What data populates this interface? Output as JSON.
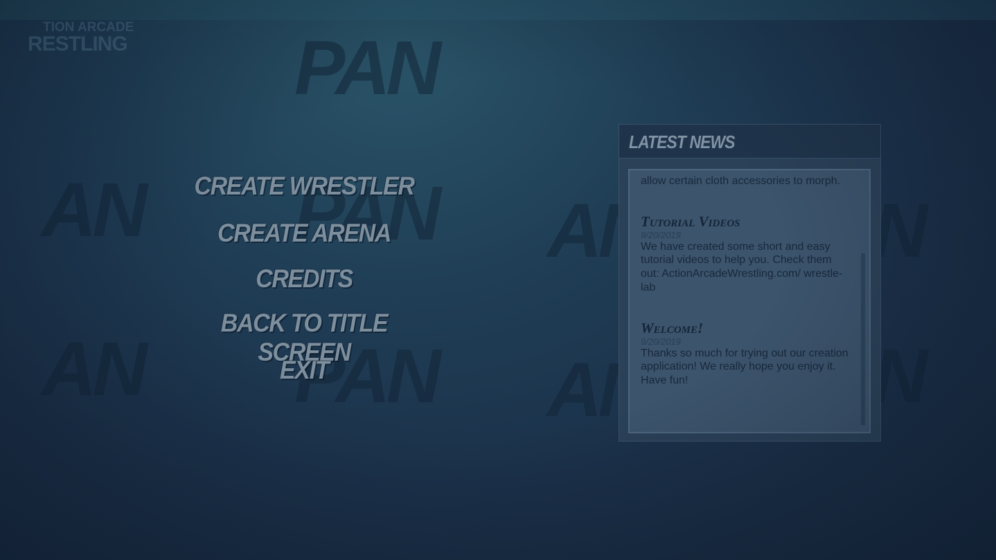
{
  "logo": {
    "line1": "TION ARCADE",
    "line2": "RESTLING"
  },
  "menu": {
    "items": [
      {
        "label": "Create Wrestler"
      },
      {
        "label": "Create Arena"
      },
      {
        "label": "Credits"
      },
      {
        "label": "Back to Title Screen"
      },
      {
        "label": "Exit"
      }
    ]
  },
  "news": {
    "title": "Latest News",
    "partial_text": "allow certain cloth accessories to morph.",
    "entries": [
      {
        "title": "Tutorial Videos",
        "date": "9/20/2019",
        "body": "We have created some short and easy tutorial videos to help you. Check them out: ActionArcadeWrestling.com/ wrestle-lab"
      },
      {
        "title": "Welcome!",
        "date": "9/20/2019",
        "body": "Thanks so much for trying out our creation application! We really hope you enjoy it. Have fun!"
      }
    ]
  },
  "colors": {
    "background": "#1f3d55",
    "menu_text": "#7d8e9d",
    "news_panel": "#2b4158",
    "news_body": "#3c546c"
  }
}
